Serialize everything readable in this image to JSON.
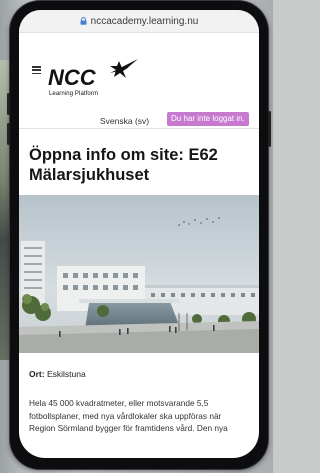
{
  "browser": {
    "url": "nccacademy.learning.nu"
  },
  "header": {
    "logo_text": "NCC",
    "logo_subtitle": "Learning Platform",
    "language": "Svenska (sv)",
    "login_status": "Du har inte loggat in."
  },
  "page": {
    "title": "Öppna info om site: E62 Mälarsjukhuset",
    "hero_alt": "Illustration of Mälarsjukhuset",
    "location_label": "Ort:",
    "location_value": "Eskilstuna",
    "body": "Hela 45 000 kvadratmeter, eller motsvarande 5,5 fotbollsplaner, med nya vårdlokaler ska uppföras när Region Sörmland bygger för framtidens vård. Den nya"
  },
  "colors": {
    "login_badge": "#c679cf",
    "logo": "#111111"
  }
}
